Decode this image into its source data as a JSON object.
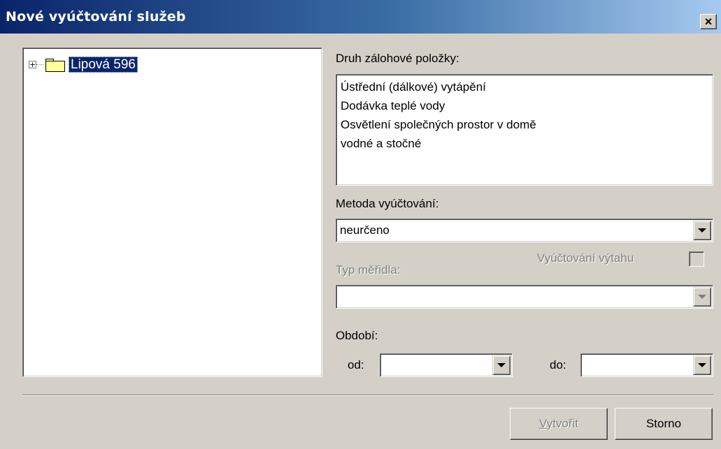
{
  "window": {
    "title": "Nové vyúčtování služeb",
    "close_glyph": "×"
  },
  "tree": {
    "expander": "+",
    "root_label": "Lipová 596"
  },
  "item_type": {
    "label": "Druh zálohové položky:",
    "options": [
      "Ústřední (dálkové) vytápění",
      "Dodávka teplé vody",
      "Osvětlení společných prostor v domě",
      "vodné a stočné"
    ]
  },
  "method": {
    "label": "Metoda vyúčtování:",
    "value": "neurčeno"
  },
  "elevator": {
    "label": "Vyúčtování výtahu",
    "checked": false
  },
  "meter_type": {
    "label": "Typ měřidla:",
    "value": ""
  },
  "period": {
    "label": "Období:",
    "from_label": "od:",
    "from_value": "",
    "to_label": "do:",
    "to_value": ""
  },
  "buttons": {
    "create_first": "V",
    "create_rest": "ytvořit",
    "cancel": "Storno"
  }
}
